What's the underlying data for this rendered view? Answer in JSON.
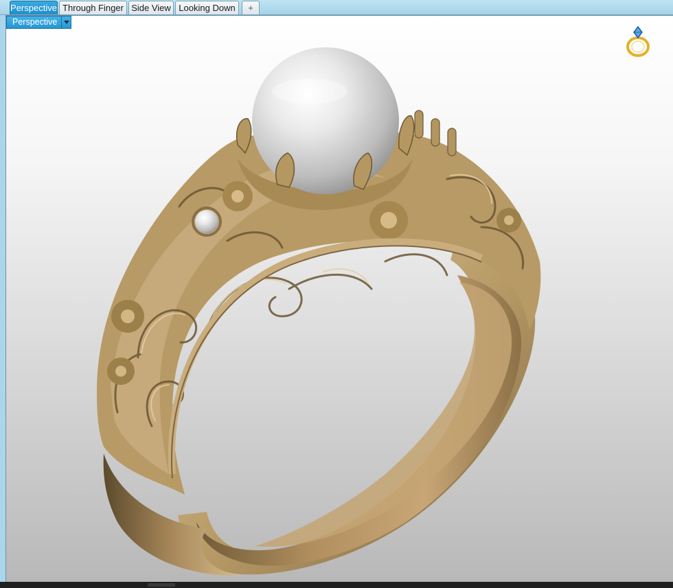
{
  "tabs": [
    {
      "label": "Perspective",
      "active": true
    },
    {
      "label": "Through Finger",
      "active": false
    },
    {
      "label": "Side View",
      "active": false
    },
    {
      "label": "Looking Down",
      "active": false
    }
  ],
  "add_tab_glyph": "+",
  "viewport": {
    "view_name": "Perspective",
    "dropdown_icon": "chevron-down-icon",
    "corner_icon": "ring-icon"
  },
  "colors": {
    "accent": "#2597d5",
    "tab_strip": "#a9d6ea",
    "gold": "#b89b67",
    "pearl": "#e6e6e6"
  }
}
